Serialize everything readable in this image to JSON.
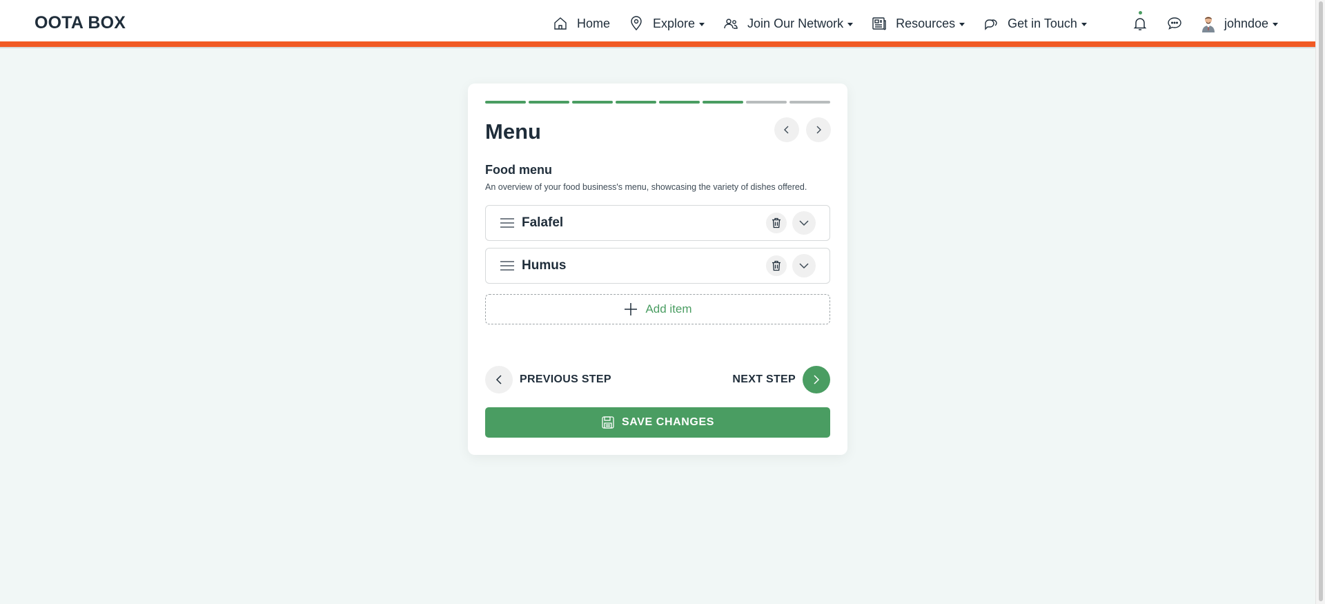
{
  "header": {
    "brand": "OOTA BOX",
    "nav": [
      {
        "label": "Home",
        "icon": "home-icon",
        "dropdown": false
      },
      {
        "label": "Explore",
        "icon": "map-pin-icon",
        "dropdown": true
      },
      {
        "label": "Join Our Network",
        "icon": "users-icon",
        "dropdown": true
      },
      {
        "label": "Resources",
        "icon": "newspaper-icon",
        "dropdown": true
      },
      {
        "label": "Get in Touch",
        "icon": "chat-bubbles-icon",
        "dropdown": true
      }
    ],
    "notification_icon": "bell-icon",
    "messages_icon": "message-icon",
    "user": {
      "name": "johndoe",
      "icon": "avatar-icon"
    }
  },
  "colors": {
    "accent": "#4a9d62",
    "header_stripe": "#f15a24",
    "background": "#f1f7f6",
    "progress_inactive": "#b8bcbd"
  },
  "wizard": {
    "progress": {
      "total_steps": 8,
      "completed_steps": 6
    },
    "title": "Menu",
    "section_title": "Food menu",
    "section_description": "An overview of your food business's menu, showcasing the variety of dishes offered.",
    "items": [
      {
        "name": "Falafel"
      },
      {
        "name": "Humus"
      }
    ],
    "add_item_label": "Add item",
    "previous_step_label": "PREVIOUS STEP",
    "next_step_label": "NEXT STEP",
    "save_label": "SAVE CHANGES"
  }
}
